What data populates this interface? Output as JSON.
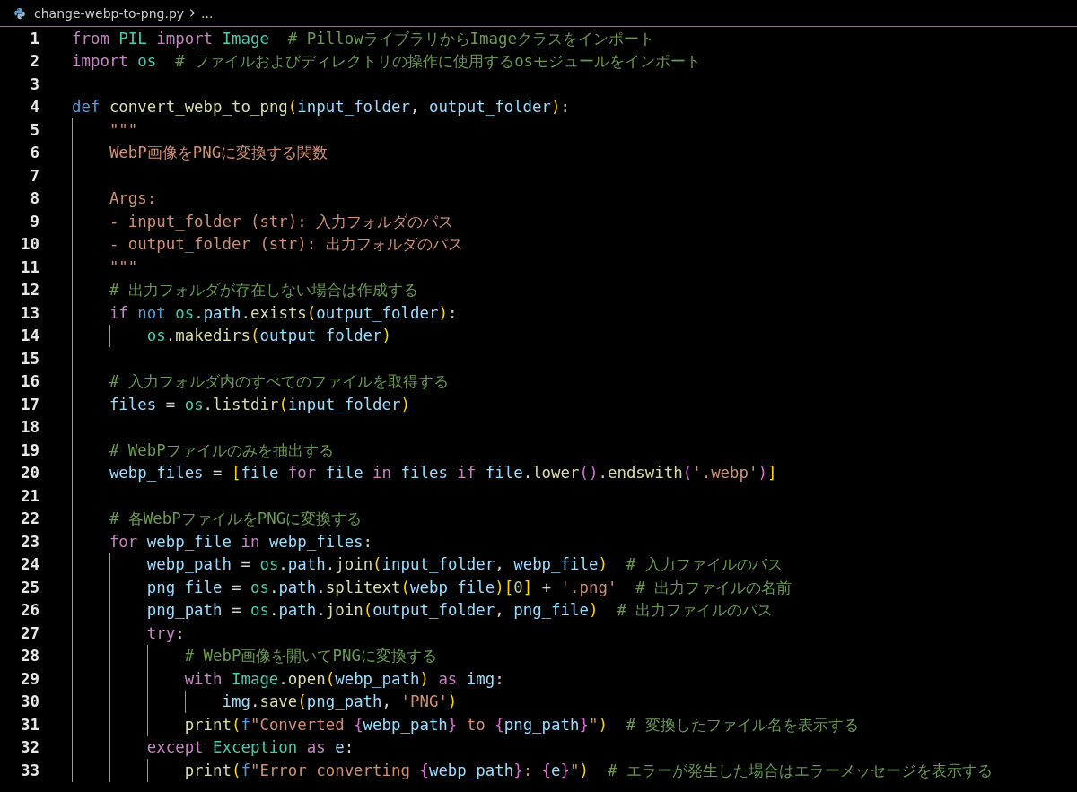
{
  "breadcrumb": {
    "file_name": "change-webp-to-png.py",
    "more": "..."
  },
  "lines": [
    {
      "number": "1",
      "tokens": [
        {
          "kind": "keyword",
          "text": "from "
        },
        {
          "kind": "class",
          "text": "PIL "
        },
        {
          "kind": "keyword",
          "text": "import "
        },
        {
          "kind": "class",
          "text": "Image  "
        },
        {
          "kind": "comment",
          "text": "# PillowライブラリからImageクラスをインポート"
        }
      ]
    },
    {
      "number": "2",
      "tokens": [
        {
          "kind": "keyword",
          "text": "import "
        },
        {
          "kind": "class",
          "text": "os  "
        },
        {
          "kind": "comment",
          "text": "# ファイルおよびディレクトリの操作に使用するosモジュールをインポート"
        }
      ]
    },
    {
      "number": "3"
    },
    {
      "number": "4",
      "tokens": [
        {
          "kind": "storage",
          "text": "def "
        },
        {
          "kind": "function",
          "text": "convert_webp_to_png"
        },
        {
          "kind": "bracket1",
          "text": "("
        },
        {
          "kind": "variable",
          "text": "input_folder"
        },
        {
          "kind": "plain",
          "text": ", "
        },
        {
          "kind": "variable",
          "text": "output_folder"
        },
        {
          "kind": "bracket1",
          "text": ")"
        },
        {
          "kind": "plain",
          "text": ":"
        }
      ],
      "children": [
        {
          "number": "5",
          "tokens": [
            {
              "kind": "string",
              "text": "\"\"\""
            }
          ]
        },
        {
          "number": "6",
          "tokens": [
            {
              "kind": "string",
              "text": "WebP画像をPNGに変換する関数"
            }
          ]
        },
        {
          "number": "7"
        },
        {
          "number": "8",
          "tokens": [
            {
              "kind": "string",
              "text": "Args:"
            }
          ]
        },
        {
          "number": "9",
          "tokens": [
            {
              "kind": "string",
              "text": "- input_folder (str): 入力フォルダのパス"
            }
          ]
        },
        {
          "number": "10",
          "tokens": [
            {
              "kind": "string",
              "text": "- output_folder (str): 出力フォルダのパス"
            }
          ]
        },
        {
          "number": "11",
          "tokens": [
            {
              "kind": "string",
              "text": "\"\"\""
            }
          ]
        },
        {
          "number": "12",
          "tokens": [
            {
              "kind": "comment",
              "text": "# 出力フォルダが存在しない場合は作成する"
            }
          ]
        },
        {
          "number": "13",
          "tokens": [
            {
              "kind": "keyword",
              "text": "if "
            },
            {
              "kind": "storage",
              "text": "not "
            },
            {
              "kind": "class",
              "text": "os"
            },
            {
              "kind": "plain",
              "text": "."
            },
            {
              "kind": "variable",
              "text": "path"
            },
            {
              "kind": "plain",
              "text": "."
            },
            {
              "kind": "function",
              "text": "exists"
            },
            {
              "kind": "bracket1",
              "text": "("
            },
            {
              "kind": "variable",
              "text": "output_folder"
            },
            {
              "kind": "bracket1",
              "text": ")"
            },
            {
              "kind": "plain",
              "text": ":"
            }
          ],
          "children": [
            {
              "number": "14",
              "tokens": [
                {
                  "kind": "class",
                  "text": "os"
                },
                {
                  "kind": "plain",
                  "text": "."
                },
                {
                  "kind": "function",
                  "text": "makedirs"
                },
                {
                  "kind": "bracket1",
                  "text": "("
                },
                {
                  "kind": "variable",
                  "text": "output_folder"
                },
                {
                  "kind": "bracket1",
                  "text": ")"
                }
              ]
            }
          ]
        },
        {
          "number": "15"
        },
        {
          "number": "16",
          "tokens": [
            {
              "kind": "comment",
              "text": "# 入力フォルダ内のすべてのファイルを取得する"
            }
          ]
        },
        {
          "number": "17",
          "tokens": [
            {
              "kind": "variable",
              "text": "files"
            },
            {
              "kind": "plain",
              "text": " = "
            },
            {
              "kind": "class",
              "text": "os"
            },
            {
              "kind": "plain",
              "text": "."
            },
            {
              "kind": "function",
              "text": "listdir"
            },
            {
              "kind": "bracket1",
              "text": "("
            },
            {
              "kind": "variable",
              "text": "input_folder"
            },
            {
              "kind": "bracket1",
              "text": ")"
            }
          ]
        },
        {
          "number": "18"
        },
        {
          "number": "19",
          "tokens": [
            {
              "kind": "comment",
              "text": "# WebPファイルのみを抽出する"
            }
          ]
        },
        {
          "number": "20",
          "tokens": [
            {
              "kind": "variable",
              "text": "webp_files"
            },
            {
              "kind": "plain",
              "text": " = "
            },
            {
              "kind": "bracket1",
              "text": "["
            },
            {
              "kind": "variable",
              "text": "file "
            },
            {
              "kind": "keyword",
              "text": "for "
            },
            {
              "kind": "variable",
              "text": "file "
            },
            {
              "kind": "keyword",
              "text": "in "
            },
            {
              "kind": "variable",
              "text": "files "
            },
            {
              "kind": "keyword",
              "text": "if "
            },
            {
              "kind": "variable",
              "text": "file"
            },
            {
              "kind": "plain",
              "text": "."
            },
            {
              "kind": "function",
              "text": "lower"
            },
            {
              "kind": "bracket2",
              "text": "()"
            },
            {
              "kind": "plain",
              "text": "."
            },
            {
              "kind": "function",
              "text": "endswith"
            },
            {
              "kind": "bracket2",
              "text": "("
            },
            {
              "kind": "string",
              "text": "'.webp'"
            },
            {
              "kind": "bracket2",
              "text": ")"
            },
            {
              "kind": "bracket1",
              "text": "]"
            }
          ]
        },
        {
          "number": "21"
        },
        {
          "number": "22",
          "tokens": [
            {
              "kind": "comment",
              "text": "# 各WebPファイルをPNGに変換する"
            }
          ]
        },
        {
          "number": "23",
          "tokens": [
            {
              "kind": "keyword",
              "text": "for "
            },
            {
              "kind": "variable",
              "text": "webp_file "
            },
            {
              "kind": "keyword",
              "text": "in "
            },
            {
              "kind": "variable",
              "text": "webp_files"
            },
            {
              "kind": "plain",
              "text": ":"
            }
          ],
          "children": [
            {
              "number": "24",
              "tokens": [
                {
                  "kind": "variable",
                  "text": "webp_path"
                },
                {
                  "kind": "plain",
                  "text": " = "
                },
                {
                  "kind": "class",
                  "text": "os"
                },
                {
                  "kind": "plain",
                  "text": "."
                },
                {
                  "kind": "variable",
                  "text": "path"
                },
                {
                  "kind": "plain",
                  "text": "."
                },
                {
                  "kind": "function",
                  "text": "join"
                },
                {
                  "kind": "bracket1",
                  "text": "("
                },
                {
                  "kind": "variable",
                  "text": "input_folder"
                },
                {
                  "kind": "plain",
                  "text": ", "
                },
                {
                  "kind": "variable",
                  "text": "webp_file"
                },
                {
                  "kind": "bracket1",
                  "text": ")  "
                },
                {
                  "kind": "comment",
                  "text": "# 入力ファイルのパス"
                }
              ]
            },
            {
              "number": "25",
              "tokens": [
                {
                  "kind": "variable",
                  "text": "png_file"
                },
                {
                  "kind": "plain",
                  "text": " = "
                },
                {
                  "kind": "class",
                  "text": "os"
                },
                {
                  "kind": "plain",
                  "text": "."
                },
                {
                  "kind": "variable",
                  "text": "path"
                },
                {
                  "kind": "plain",
                  "text": "."
                },
                {
                  "kind": "function",
                  "text": "splitext"
                },
                {
                  "kind": "bracket1",
                  "text": "("
                },
                {
                  "kind": "variable",
                  "text": "webp_file"
                },
                {
                  "kind": "bracket1",
                  "text": ")["
                },
                {
                  "kind": "number",
                  "text": "0"
                },
                {
                  "kind": "bracket1",
                  "text": "]"
                },
                {
                  "kind": "plain",
                  "text": " + "
                },
                {
                  "kind": "string",
                  "text": "'.png'  "
                },
                {
                  "kind": "comment",
                  "text": "# 出力ファイルの名前"
                }
              ]
            },
            {
              "number": "26",
              "tokens": [
                {
                  "kind": "variable",
                  "text": "png_path"
                },
                {
                  "kind": "plain",
                  "text": " = "
                },
                {
                  "kind": "class",
                  "text": "os"
                },
                {
                  "kind": "plain",
                  "text": "."
                },
                {
                  "kind": "variable",
                  "text": "path"
                },
                {
                  "kind": "plain",
                  "text": "."
                },
                {
                  "kind": "function",
                  "text": "join"
                },
                {
                  "kind": "bracket1",
                  "text": "("
                },
                {
                  "kind": "variable",
                  "text": "output_folder"
                },
                {
                  "kind": "plain",
                  "text": ", "
                },
                {
                  "kind": "variable",
                  "text": "png_file"
                },
                {
                  "kind": "bracket1",
                  "text": ")  "
                },
                {
                  "kind": "comment",
                  "text": "# 出力ファイルのパス"
                }
              ]
            },
            {
              "number": "27",
              "tokens": [
                {
                  "kind": "keyword",
                  "text": "try"
                },
                {
                  "kind": "plain",
                  "text": ":"
                }
              ],
              "children": [
                {
                  "number": "28",
                  "tokens": [
                    {
                      "kind": "comment",
                      "text": "# WebP画像を開いてPNGに変換する"
                    }
                  ]
                },
                {
                  "number": "29",
                  "tokens": [
                    {
                      "kind": "keyword",
                      "text": "with "
                    },
                    {
                      "kind": "class",
                      "text": "Image"
                    },
                    {
                      "kind": "plain",
                      "text": "."
                    },
                    {
                      "kind": "function",
                      "text": "open"
                    },
                    {
                      "kind": "bracket1",
                      "text": "("
                    },
                    {
                      "kind": "variable",
                      "text": "webp_path"
                    },
                    {
                      "kind": "bracket1",
                      "text": ")"
                    },
                    {
                      "kind": "keyword",
                      "text": " as "
                    },
                    {
                      "kind": "variable",
                      "text": "img"
                    },
                    {
                      "kind": "plain",
                      "text": ":"
                    }
                  ],
                  "children": [
                    {
                      "number": "30",
                      "tokens": [
                        {
                          "kind": "variable",
                          "text": "img"
                        },
                        {
                          "kind": "plain",
                          "text": "."
                        },
                        {
                          "kind": "function",
                          "text": "save"
                        },
                        {
                          "kind": "bracket1",
                          "text": "("
                        },
                        {
                          "kind": "variable",
                          "text": "png_path"
                        },
                        {
                          "kind": "plain",
                          "text": ", "
                        },
                        {
                          "kind": "string",
                          "text": "'PNG'"
                        },
                        {
                          "kind": "bracket1",
                          "text": ")"
                        }
                      ]
                    }
                  ]
                },
                {
                  "number": "31",
                  "tokens": [
                    {
                      "kind": "function",
                      "text": "print"
                    },
                    {
                      "kind": "bracket1",
                      "text": "("
                    },
                    {
                      "kind": "storage",
                      "text": "f"
                    },
                    {
                      "kind": "string",
                      "text": "\"Converted "
                    },
                    {
                      "kind": "bracket2",
                      "text": "{"
                    },
                    {
                      "kind": "variable",
                      "text": "webp_path"
                    },
                    {
                      "kind": "bracket2",
                      "text": "}"
                    },
                    {
                      "kind": "string",
                      "text": " to "
                    },
                    {
                      "kind": "bracket2",
                      "text": "{"
                    },
                    {
                      "kind": "variable",
                      "text": "png_path"
                    },
                    {
                      "kind": "bracket2",
                      "text": "}"
                    },
                    {
                      "kind": "string",
                      "text": "\""
                    },
                    {
                      "kind": "bracket1",
                      "text": ")  "
                    },
                    {
                      "kind": "comment",
                      "text": "# 変換したファイル名を表示する"
                    }
                  ]
                }
              ]
            },
            {
              "number": "32",
              "tokens": [
                {
                  "kind": "keyword",
                  "text": "except "
                },
                {
                  "kind": "class",
                  "text": "Exception "
                },
                {
                  "kind": "keyword",
                  "text": "as "
                },
                {
                  "kind": "variable",
                  "text": "e"
                },
                {
                  "kind": "plain",
                  "text": ":"
                }
              ],
              "children": [
                {
                  "number": "33",
                  "tokens": [
                    {
                      "kind": "function",
                      "text": "print"
                    },
                    {
                      "kind": "bracket1",
                      "text": "("
                    },
                    {
                      "kind": "storage",
                      "text": "f"
                    },
                    {
                      "kind": "string",
                      "text": "\"Error converting "
                    },
                    {
                      "kind": "bracket2",
                      "text": "{"
                    },
                    {
                      "kind": "variable",
                      "text": "webp_path"
                    },
                    {
                      "kind": "bracket2",
                      "text": "}"
                    },
                    {
                      "kind": "string",
                      "text": ": "
                    },
                    {
                      "kind": "bracket2",
                      "text": "{"
                    },
                    {
                      "kind": "variable",
                      "text": "e"
                    },
                    {
                      "kind": "bracket2",
                      "text": "}"
                    },
                    {
                      "kind": "string",
                      "text": "\""
                    },
                    {
                      "kind": "bracket1",
                      "text": ")  "
                    },
                    {
                      "kind": "comment",
                      "text": "# エラーが発生した場合はエラーメッセージを表示する"
                    }
                  ]
                }
              ]
            }
          ]
        }
      ]
    }
  ]
}
